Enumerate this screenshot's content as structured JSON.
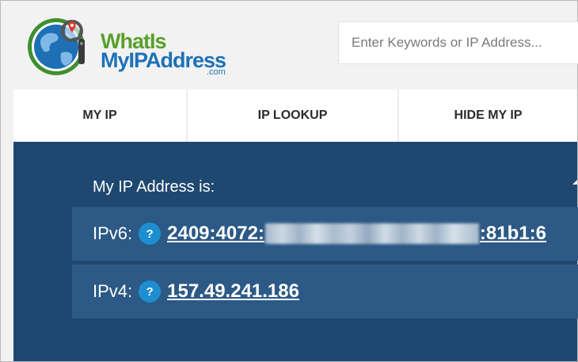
{
  "header": {
    "logo": {
      "line1": "WhatIs",
      "line2": "MyIPAddress",
      "suffix": ".com"
    },
    "search": {
      "placeholder": "Enter Keywords or IP Address..."
    }
  },
  "nav": {
    "items": [
      {
        "label": "MY IP"
      },
      {
        "label": "IP LOOKUP"
      },
      {
        "label": "HIDE MY IP"
      }
    ]
  },
  "main": {
    "title": "My IP Address is:",
    "ipv6": {
      "label": "IPv6:",
      "help": "?",
      "prefix": "2409:4072:",
      "suffix": ":81b1:6"
    },
    "ipv4": {
      "label": "IPv4:",
      "help": "?",
      "value": "157.49.241.186"
    }
  },
  "colors": {
    "brand_green": "#5aa02c",
    "brand_blue": "#1d72b8",
    "panel_bg": "#1f4870",
    "row_bg": "#2c5985",
    "help_badge": "#1d8ed0"
  }
}
